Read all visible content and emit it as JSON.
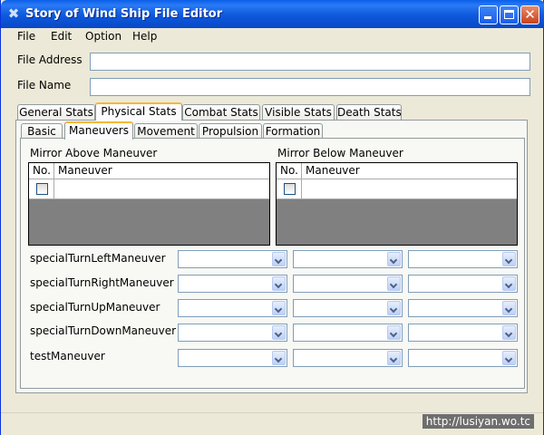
{
  "window": {
    "title": "Story of Wind Ship File Editor",
    "icon": "x-logo-icon",
    "controls": [
      "minimize",
      "maximize",
      "close"
    ],
    "close_glyph": "✕",
    "app_icon_glyph": "✖"
  },
  "menu": [
    "File",
    "Edit",
    "Option",
    "Help"
  ],
  "fields": {
    "file_address": {
      "label": "File Address",
      "value": ""
    },
    "file_name": {
      "label": "File Name",
      "value": ""
    }
  },
  "main_tabs": [
    "General Stats",
    "Physical Stats",
    "Combat Stats",
    "Visible Stats",
    "Death Stats"
  ],
  "main_tabs_active": "Physical Stats",
  "sub_tabs": [
    "Basic",
    "Maneuvers",
    "Movement",
    "Propulsion",
    "Formation"
  ],
  "sub_tabs_active": "Maneuvers",
  "mirror_above": {
    "label": "Mirror Above Maneuver",
    "columns": [
      "No.",
      "Maneuver"
    ]
  },
  "mirror_below": {
    "label": "Mirror Below Maneuver",
    "columns": [
      "No.",
      "Maneuver"
    ]
  },
  "maneuver_rows": [
    {
      "label": "specialTurnLeftManeuver"
    },
    {
      "label": "specialTurnRightManeuver"
    },
    {
      "label": "specialTurnUpManeuver"
    },
    {
      "label": "specialTurnDownManeuver"
    },
    {
      "label": "testManeuver"
    }
  ],
  "combos_per_row": 3,
  "watermark": "http://lusiyan.wo.tc",
  "colors": {
    "titlebar": "#0a5fe8",
    "window_bg": "#ece9d8",
    "active_tab_accent": "#f8b63a",
    "grid_empty": "#808080",
    "close_button": "#c9421a"
  }
}
